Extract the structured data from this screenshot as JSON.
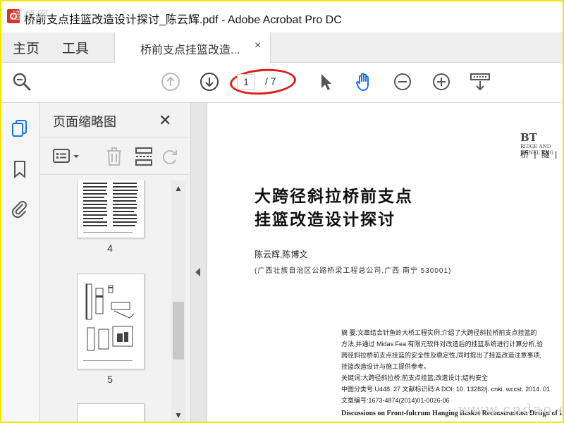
{
  "window": {
    "title": "桥前支点挂篮改造设计探讨_陈云辉.pdf - Adobe Acrobat Pro DC",
    "watermark_top": "道桥网"
  },
  "tabs": {
    "home": "主页",
    "tools": "工具",
    "document_tab": "桥前支点挂篮改造...",
    "close": "×"
  },
  "toolbar": {
    "current_page": "1",
    "total_pages": "/ 7",
    "highlight_color": "#e01e1e",
    "accent_color": "#1473e6",
    "icons": [
      "search-icon",
      "prev-page-icon",
      "next-page-icon",
      "select-arrow-icon",
      "hand-icon",
      "zoom-out-icon",
      "zoom-in-icon",
      "scroll-mode-icon"
    ]
  },
  "thumbnails_panel": {
    "title": "页面缩略图",
    "close": "✕",
    "pages": [
      {
        "label": "4"
      },
      {
        "label": "5"
      }
    ]
  },
  "document": {
    "journal_logo_line1": "RIDGE AND",
    "journal_logo_line2": "UNNEL ENG",
    "journal_logo_initials": "BT",
    "journal_cn": "桥 | 隧 | 工",
    "title_line1": "大跨径斜拉桥前支点",
    "title_line2": "挂篮改造设计探讨",
    "authors": "陈云辉,陈博文",
    "affiliation": "(广西壮族自治区公路桥梁工程总公司,广西   南宁   530001)",
    "abstract_lines": [
      "摘    要:文章结合针鱼岭大桥工程实例,介绍了大跨径斜拉桥前支点挂篮的",
      "方法,并通过 Midas Fea 有限元软件对改造后的挂篮系统进行计算分析,验",
      "跨径斜拉桥前支点挂篮的安全性及稳定性,同时提出了挂篮改造注意事项,",
      "挂篮改造设计与施工提供参考。",
      "关键词:大跨径斜拉桥;前支点挂篮;改造设计;结构安全",
      "中图分类号:U448. 27    文献标识码:A    DOI: 10. 13282/j. cnki. wccst. 2014. 01",
      "文章编号:1673-4874(2014)01-0026-06"
    ],
    "english_title": "Discussions on Front-fulcrum Hanging Basket Reconstruction Design of L",
    "watermark_bottom": "www.cndao.com"
  }
}
